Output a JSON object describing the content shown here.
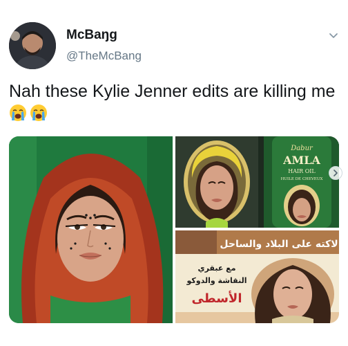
{
  "author": {
    "display_name": "McBaŋg",
    "handle": "@TheMcBang"
  },
  "tweet": {
    "text": "Nah these Kylie Jenner edits are killing me",
    "emojis": [
      "loudly-crying-face",
      "loudly-crying-face"
    ]
  },
  "media": {
    "images": [
      {
        "name": "headscarf-edit"
      },
      {
        "name": "amla-hair-oil-edit",
        "brand": "Dabur",
        "product": "AMLA",
        "subtitle": "HAIR OIL",
        "tagline": "HUILE DE CHEVEUX"
      },
      {
        "name": "arabic-poster-edit",
        "banner": "لاكته على البلاد والساحل",
        "line1": "مع عبقري",
        "line2": "النقاشة والدوكو",
        "line3": "الأسطى"
      }
    ]
  },
  "colors": {
    "text_primary": "#14171a",
    "text_secondary": "#657786",
    "background": "#ffffff"
  }
}
